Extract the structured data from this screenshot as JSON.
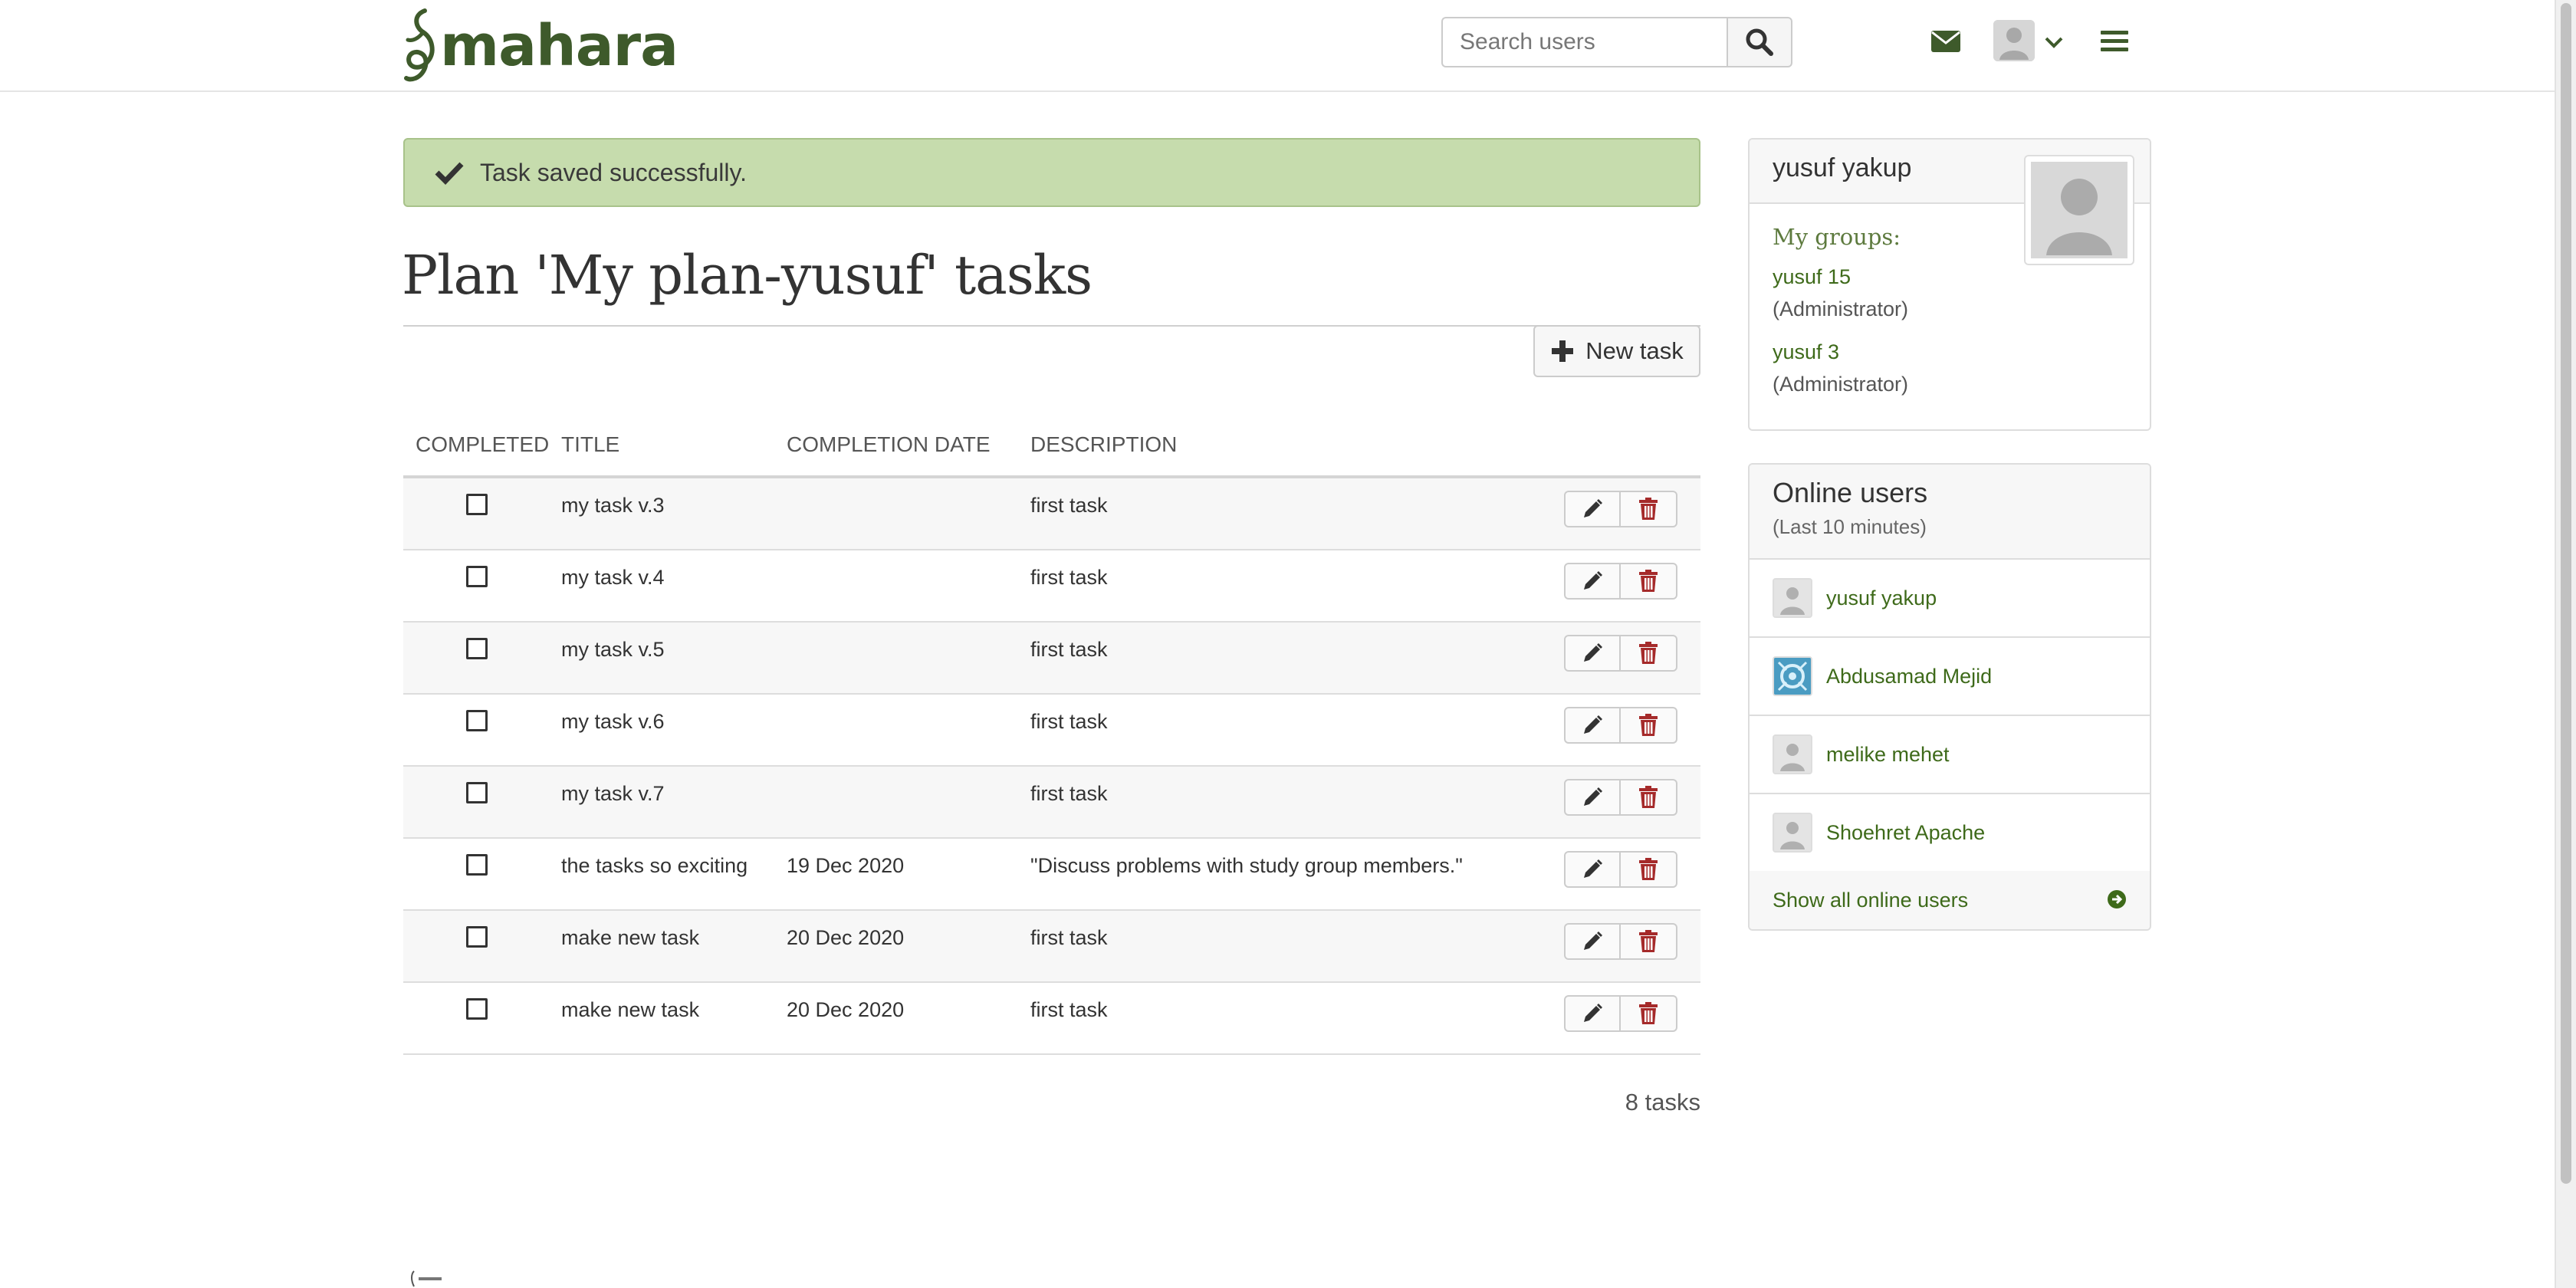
{
  "header": {
    "logo_text": "mahara",
    "search_placeholder": "Search users",
    "icons": {
      "search": "search-icon",
      "mail": "envelope-icon",
      "user_menu": "chevron-down-icon",
      "main_menu": "hamburger-menu-icon"
    }
  },
  "alert": {
    "icon": "check-icon",
    "text": "Task saved successfully."
  },
  "page": {
    "title": "Plan 'My plan-yusuf' tasks",
    "new_task_label": "New task",
    "task_count": "8 tasks"
  },
  "table": {
    "headers": {
      "completed": "COMPLETED",
      "title": "TITLE",
      "date": "COMPLETION DATE",
      "description": "DESCRIPTION"
    },
    "rows": [
      {
        "completed": false,
        "title": "my task v.3",
        "date": "",
        "description": "first task"
      },
      {
        "completed": false,
        "title": "my task v.4",
        "date": "",
        "description": "first task"
      },
      {
        "completed": false,
        "title": "my task v.5",
        "date": "",
        "description": "first task"
      },
      {
        "completed": false,
        "title": "my task v.6",
        "date": "",
        "description": "first task"
      },
      {
        "completed": false,
        "title": "my task v.7",
        "date": "",
        "description": "first task"
      },
      {
        "completed": false,
        "title": "the tasks so exciting",
        "date": "19 Dec 2020",
        "description": "\"Discuss problems with study group members.\""
      },
      {
        "completed": false,
        "title": "make new task",
        "date": "20 Dec 2020",
        "description": "first task"
      },
      {
        "completed": false,
        "title": "make new task",
        "date": "20 Dec 2020",
        "description": "first task"
      }
    ]
  },
  "sidebar": {
    "profile": {
      "name": "yusuf yakup",
      "groups_label": "My groups:",
      "groups": [
        {
          "name": "yusuf 15",
          "role": "(Administrator)"
        },
        {
          "name": "yusuf 3",
          "role": "(Administrator)"
        }
      ]
    },
    "online_users": {
      "title": "Online users",
      "subtitle": "(Last 10 minutes)",
      "users": [
        {
          "name": "yusuf yakup"
        },
        {
          "name": "Abdusamad Mejid"
        },
        {
          "name": "melike mehet"
        },
        {
          "name": "Shoehret Apache"
        }
      ],
      "show_all_label": "Show all online users"
    }
  },
  "colors": {
    "brand": "#3e5a2b",
    "alert_bg": "#c6dcad",
    "delete": "#a52a2a",
    "link": "#3e6a1a"
  }
}
